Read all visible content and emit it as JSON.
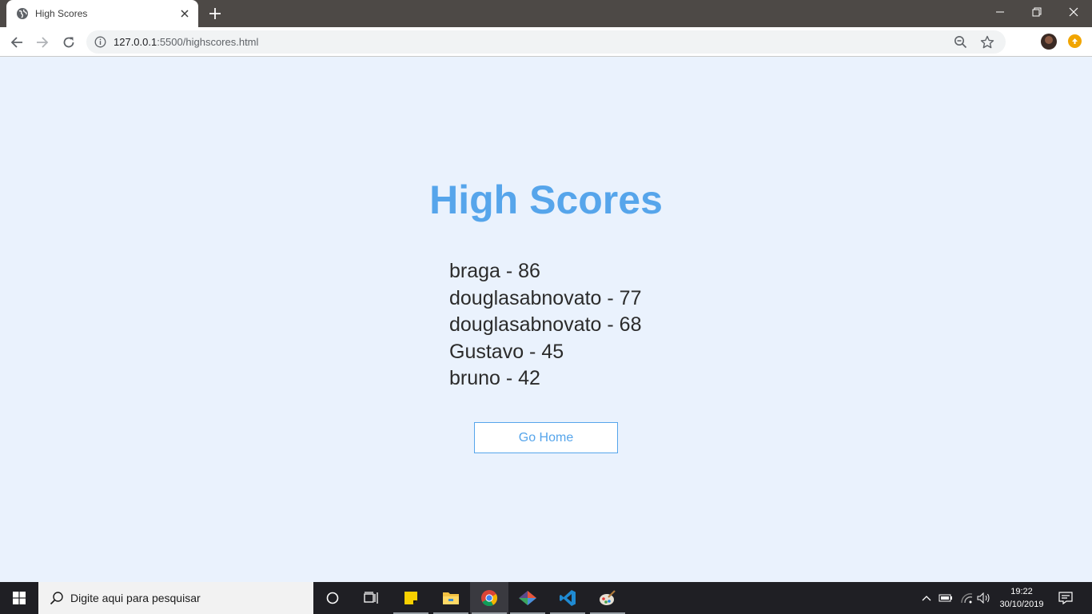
{
  "browser": {
    "tab": {
      "title": "High Scores"
    },
    "url": {
      "host": "127.0.0.1",
      "path": ":5500/highscores.html"
    },
    "icons": [
      "globe-icon",
      "close-icon",
      "plus-icon",
      "minimize-icon",
      "restore-icon",
      "window-close-icon",
      "back-arrow-icon",
      "forward-arrow-icon",
      "reload-icon",
      "info-icon",
      "zoom-icon",
      "star-icon",
      "avatar",
      "extension-icon"
    ]
  },
  "page": {
    "title": "High Scores",
    "scores": [
      {
        "text": "braga - 86"
      },
      {
        "text": "douglasabnovato - 77"
      },
      {
        "text": "douglasabnovato - 68"
      },
      {
        "text": "Gustavo - 45"
      },
      {
        "text": "bruno - 42"
      }
    ],
    "button_label": "Go Home",
    "colors": {
      "accent": "#56a5eb",
      "background": "#eaf2fd",
      "text": "#2b2b2b"
    }
  },
  "taskbar": {
    "search_placeholder": "Digite aqui para pesquisar",
    "apps": [
      "cortana-icon",
      "task-view-icon",
      "sticky-notes-icon",
      "file-explorer-icon",
      "chrome-icon",
      "git-icon",
      "vscode-icon",
      "paint-icon"
    ],
    "tray_icons": [
      "chevron-up-icon",
      "battery-icon",
      "wifi-icon",
      "volume-icon",
      "notifications-icon"
    ],
    "time": "19:22",
    "date": "30/10/2019"
  }
}
